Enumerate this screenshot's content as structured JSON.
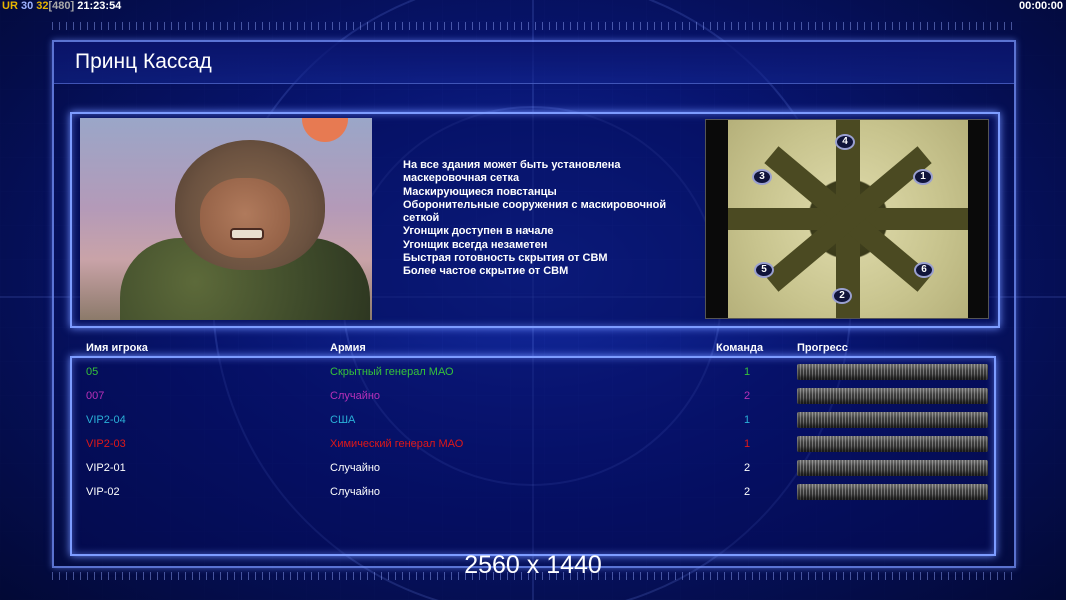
{
  "hud": {
    "ur_label": "UR",
    "ur_value": "30",
    "second_value": "32",
    "bracket_value": "[480]",
    "clock": "21:23:54",
    "timer": "00:00:00"
  },
  "general": {
    "title": "Принц Кассад",
    "perks": [
      "На все здания может быть установлена",
      " маскеровочная сетка",
      "Маскирующиеся повстанцы",
      "Оборонительные сооружения с маскировочной",
      " сеткой",
      "Угонщик доступен в начале",
      "Угонщик всегда незаметен",
      "Быстрая готовность скрытия от СВМ",
      "Более частое скрытие от СВМ"
    ]
  },
  "minimap": {
    "spots": [
      "1",
      "2",
      "3",
      "4",
      "5",
      "6"
    ]
  },
  "table": {
    "headers": {
      "player": "Имя игрока",
      "army": "Армия",
      "team": "Команда",
      "progress": "Прогресс"
    },
    "rows": [
      {
        "player": "05",
        "army": "Скрытный генерал МАО",
        "team": "1",
        "color": "#36c23a"
      },
      {
        "player": "007",
        "army": "Случайно",
        "team": "2",
        "color": "#b830b8"
      },
      {
        "player": "VIP2-04",
        "army": "США",
        "team": "1",
        "color": "#2ab0d8"
      },
      {
        "player": "VIP2-03",
        "army": "Химический генерал МАО",
        "team": "1",
        "color": "#e01818"
      },
      {
        "player": "VIP2-01",
        "army": "Случайно",
        "team": "2",
        "color": "#ffffff"
      },
      {
        "player": "VIP-02",
        "army": "Случайно",
        "team": "2",
        "color": "#ffffff"
      }
    ]
  },
  "resolution": "2560 x 1440",
  "colors": {
    "ur": "#e6b400",
    "hud_number": "#e6b400",
    "bracket": "#aaaaaa",
    "frame": "#7d9cff"
  }
}
